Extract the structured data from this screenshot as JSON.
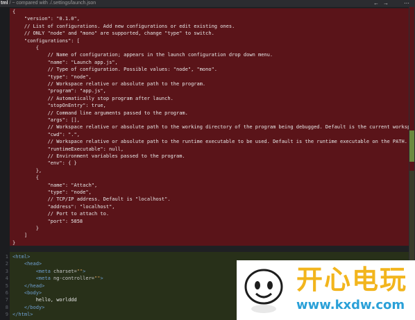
{
  "titlebar": {
    "filename": "tml",
    "compare_text": "/ ~ compared with ./.settings/launch.json",
    "prev_icon": "left-arrow",
    "next_icon": "right-arrow",
    "menu_icon": "ellipsis"
  },
  "colors": {
    "deleted_bg": "#5a1419",
    "inserted_bg": "#283019",
    "tag": "#6f9fd1",
    "string": "#d89f5a"
  },
  "removed_lines": [
    "{",
    "    \"version\": \"0.1.0\",",
    "    // List of configurations. Add new configurations or edit existing ones.",
    "    // ONLY \"node\" and \"mono\" are supported, change \"type\" to switch.",
    "    \"configurations\": [",
    "        {",
    "            // Name of configuration; appears in the launch configuration drop down menu.",
    "            \"name\": \"Launch app.js\",",
    "            // Type of configuration. Possible values: \"node\", \"mono\".",
    "            \"type\": \"node\",",
    "            // Workspace relative or absolute path to the program.",
    "            \"program\": \"app.js\",",
    "            // Automatically stop program after launch.",
    "            \"stopOnEntry\": true,",
    "            // Command line arguments passed to the program.",
    "            \"args\": [],",
    "            // Workspace relative or absolute path to the working directory of the program being debugged. Default is the current workspace.",
    "            \"cwd\": \".\",",
    "            // Workspace relative or absolute path to the runtime executable to be used. Default is the runtime executable on the PATH.",
    "            \"runtimeExecutable\": null,",
    "            // Environment variables passed to the program.",
    "            \"env\": { }",
    "        },",
    "        {",
    "            \"name\": \"Attach\",",
    "            \"type\": \"node\",",
    "            // TCP/IP address. Default is \"localhost\".",
    "            \"address\": \"localhost\",",
    "            // Port to attach to.",
    "            \"port\": 5858",
    "        }",
    "    ]",
    "}"
  ],
  "added_lines": [
    {
      "num": "1",
      "indent": "",
      "parts": [
        {
          "t": "<html>",
          "c": "tag"
        }
      ]
    },
    {
      "num": "2",
      "indent": "    ",
      "parts": [
        {
          "t": "<head>",
          "c": "tag"
        }
      ]
    },
    {
      "num": "3",
      "indent": "        ",
      "parts": [
        {
          "t": "<meta ",
          "c": "tag"
        },
        {
          "t": "charset=",
          "c": "att"
        },
        {
          "t": "\"\"",
          "c": "str"
        },
        {
          "t": ">",
          "c": "tag"
        }
      ]
    },
    {
      "num": "4",
      "indent": "        ",
      "parts": [
        {
          "t": "<meta ",
          "c": "tag"
        },
        {
          "t": "ng-controller=",
          "c": "att"
        },
        {
          "t": "\"\"",
          "c": "str"
        },
        {
          "t": ">",
          "c": "tag"
        }
      ]
    },
    {
      "num": "5",
      "indent": "    ",
      "parts": [
        {
          "t": "</head>",
          "c": "tag"
        }
      ]
    },
    {
      "num": "6",
      "indent": "    ",
      "parts": [
        {
          "t": "<body>",
          "c": "tag"
        }
      ]
    },
    {
      "num": "7",
      "indent": "        ",
      "parts": [
        {
          "t": "hello, worlddd",
          "c": "txt"
        }
      ]
    },
    {
      "num": "8",
      "indent": "    ",
      "parts": [
        {
          "t": "</body>",
          "c": "tag"
        }
      ]
    },
    {
      "num": "9",
      "indent": "",
      "parts": [
        {
          "t": "</html>",
          "c": "tag"
        }
      ]
    }
  ],
  "watermark": {
    "brand": "开心电玩",
    "url": "www.kxdw.com"
  }
}
